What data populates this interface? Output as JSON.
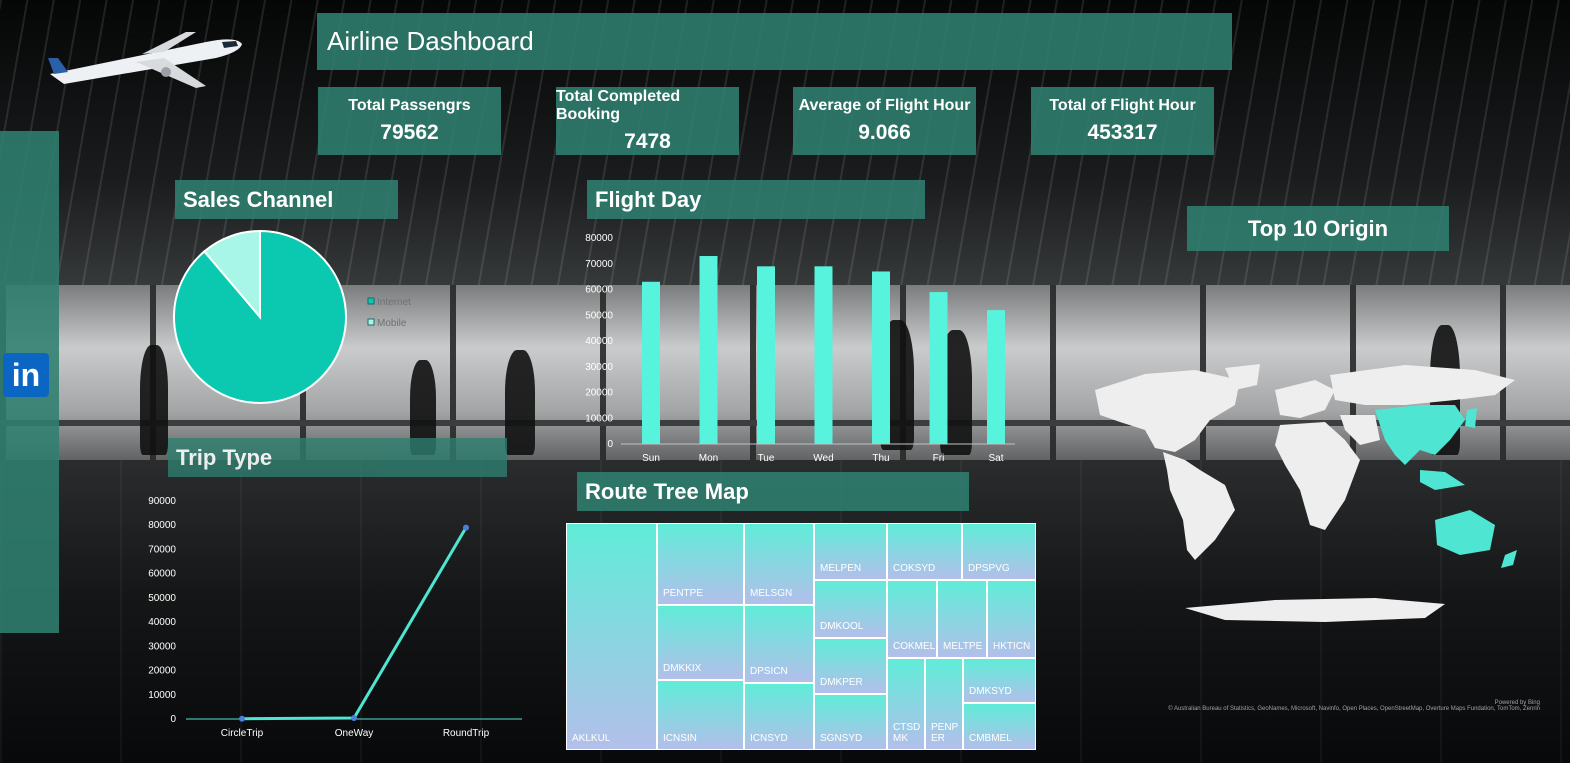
{
  "header": {
    "title": "Airline Dashboard"
  },
  "kpis": [
    {
      "label": "Total Passengrs",
      "value": "79562"
    },
    {
      "label": "Total Completed Booking",
      "value": "7478"
    },
    {
      "label": "Average of Flight Hour",
      "value": "9.066"
    },
    {
      "label": "Total of Flight Hour",
      "value": "453317"
    }
  ],
  "sections": {
    "sales_channel": "Sales Channel",
    "flight_day": "Flight Day",
    "trip_type": "Trip Type",
    "route_tree_map": "Route Tree Map",
    "top_origin": "Top 10 Origin"
  },
  "colors": {
    "panel": "#2f8070",
    "internet": "#0bc9b0",
    "mobile": "#a8f6e8",
    "bar": "#57f3dc",
    "line": "#4ee6d2",
    "marker": "#4d7fd9"
  },
  "map_attribution": {
    "powered": "Powered by Bing",
    "credits": "© Australian Bureau of Statistics, GeoNames, Microsoft, Navinfo, Open Places, OpenStreetMap, Overture Maps Fundation, TomTom, Zenrin"
  },
  "icons": {
    "plane": "airplane-icon",
    "linkedin": "linkedin-icon"
  },
  "chart_data": [
    {
      "id": "sales_channel",
      "type": "pie",
      "title": "Sales Channel",
      "categories": [
        "Internet",
        "Mobile"
      ],
      "values": [
        88.8,
        11.2
      ],
      "legend": "right"
    },
    {
      "id": "flight_day",
      "type": "bar",
      "title": "Flight Day",
      "categories": [
        "Sun",
        "Mon",
        "Tue",
        "Wed",
        "Thu",
        "Fri",
        "Sat"
      ],
      "values": [
        63000,
        73000,
        69000,
        69000,
        67000,
        59000,
        52000
      ],
      "ylim": [
        0,
        80000
      ],
      "yticks": [
        "0",
        "10000",
        "20000",
        "30000",
        "40000",
        "50000",
        "60000",
        "70000",
        "80000"
      ]
    },
    {
      "id": "trip_type",
      "type": "line",
      "title": "Trip Type",
      "categories": [
        "CircleTrip",
        "OneWay",
        "RoundTrip"
      ],
      "values": [
        100,
        400,
        79000
      ],
      "ylim": [
        0,
        90000
      ],
      "yticks": [
        "0",
        "10000",
        "20000",
        "30000",
        "40000",
        "50000",
        "60000",
        "70000",
        "80000",
        "90000"
      ]
    },
    {
      "id": "route_tree_map",
      "type": "treemap",
      "title": "Route Tree Map",
      "labels": [
        "AKLKUL",
        "PENTPE",
        "MELSGN",
        "MELPEN",
        "COKSYD",
        "DPSPVG",
        "DMKKIX",
        "DPSICN",
        "DMKOOL",
        "COKMEL",
        "MELTPE",
        "HKTICN",
        "DMKPER",
        "ICNSIN",
        "ICNSYD",
        "SGNSYD",
        "CTSDMK",
        "PENPER",
        "DMKSYD",
        "CMBMEL"
      ]
    },
    {
      "id": "top_origin",
      "type": "map",
      "title": "Top 10 Origin",
      "highlighted_regions": [
        "Asia",
        "Australia"
      ]
    }
  ]
}
